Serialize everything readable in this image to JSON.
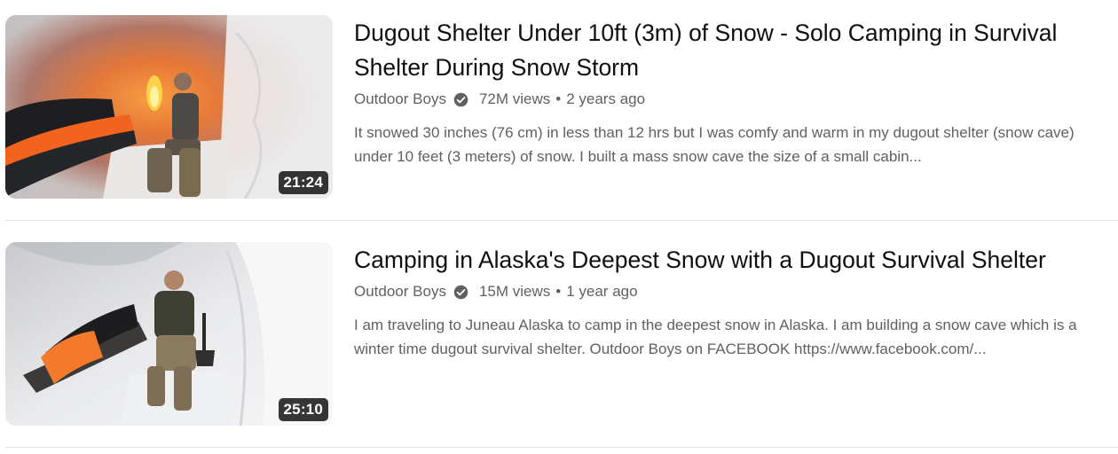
{
  "results": [
    {
      "title": "Dugout Shelter Under 10ft (3m) of Snow - Solo Camping in Survival Shelter During Snow Storm",
      "channel": "Outdoor Boys",
      "views": "72M views",
      "separator": "•",
      "age": "2 years ago",
      "description_line1": "It snowed 30 inches (76 cm) in less than 12 hrs but I was comfy and warm in my dugout shelter (snow cave)",
      "description_line2": "under 10 feet (3 meters) of snow. I built a mass snow cave the size of a small cabin...",
      "duration": "21:24"
    },
    {
      "title": "Camping in Alaska's Deepest Snow with a Dugout Survival Shelter",
      "channel": "Outdoor Boys",
      "views": "15M views",
      "separator": "•",
      "age": "1 year ago",
      "description_line1": "I am traveling to Juneau Alaska to camp in the deepest snow in Alaska. I am building a snow cave which is a",
      "description_line2": "winter time dugout survival shelter. Outdoor Boys on FACEBOOK https://www.facebook.com/...",
      "duration": "25:10"
    }
  ],
  "icons": {
    "verified": "verified-check-icon"
  },
  "colors": {
    "title": "#0f0f0f",
    "secondary_text": "#606060",
    "duration_bg": "#000000",
    "divider": "#e5e5e5"
  }
}
